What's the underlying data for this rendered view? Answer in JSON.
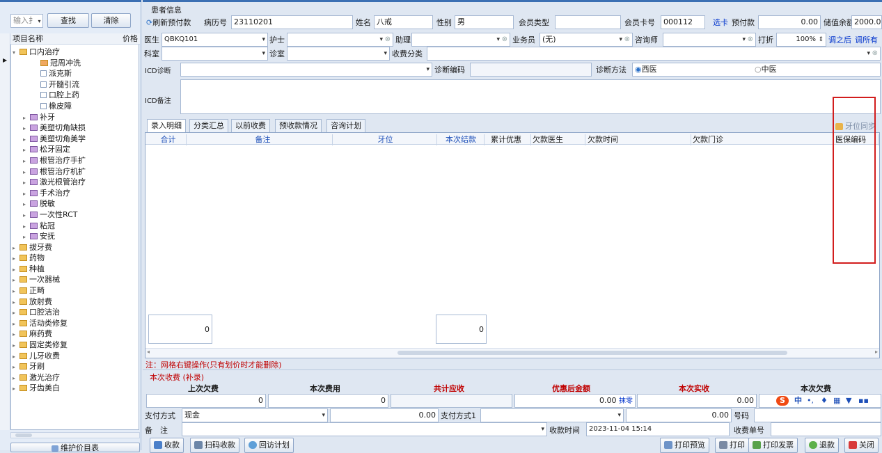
{
  "left": {
    "search_placeholder": "输入扌",
    "find_label": "查找",
    "clear_label": "清除",
    "col_name": "项目名称",
    "col_price": "价格",
    "maintain_label": "维护价目表",
    "tree": [
      {
        "label": "口内治疗",
        "indent": 0,
        "icon": "folder-open",
        "exp": "▾"
      },
      {
        "label": "冠周冲洗",
        "indent": 2,
        "icon": "pen",
        "exp": ""
      },
      {
        "label": "派克斯",
        "indent": 2,
        "icon": "check",
        "exp": ""
      },
      {
        "label": "开髓引流",
        "indent": 2,
        "icon": "check",
        "exp": ""
      },
      {
        "label": "口腔上药",
        "indent": 2,
        "icon": "check",
        "exp": ""
      },
      {
        "label": "橡皮障",
        "indent": 2,
        "icon": "check",
        "exp": ""
      },
      {
        "label": "补牙",
        "indent": 1,
        "icon": "pile",
        "exp": "▸"
      },
      {
        "label": "美塑切角缺损",
        "indent": 1,
        "icon": "pile",
        "exp": "▸"
      },
      {
        "label": "美塑切角美学",
        "indent": 1,
        "icon": "pile",
        "exp": "▸"
      },
      {
        "label": "松牙固定",
        "indent": 1,
        "icon": "pile",
        "exp": "▸"
      },
      {
        "label": "根管治疗手扩",
        "indent": 1,
        "icon": "pile",
        "exp": "▸"
      },
      {
        "label": "根管治疗机扩",
        "indent": 1,
        "icon": "pile",
        "exp": "▸"
      },
      {
        "label": "激光根管治疗",
        "indent": 1,
        "icon": "pile",
        "exp": "▸"
      },
      {
        "label": "手术治疗",
        "indent": 1,
        "icon": "pile",
        "exp": "▸"
      },
      {
        "label": "脱敏",
        "indent": 1,
        "icon": "pile",
        "exp": "▸"
      },
      {
        "label": "一次性RCT",
        "indent": 1,
        "icon": "pile",
        "exp": "▸"
      },
      {
        "label": "粘冠",
        "indent": 1,
        "icon": "pile",
        "exp": "▸"
      },
      {
        "label": "安抚",
        "indent": 1,
        "icon": "pile",
        "exp": "▸"
      },
      {
        "label": "拔牙费",
        "indent": 0,
        "icon": "folder",
        "exp": "▸"
      },
      {
        "label": "药物",
        "indent": 0,
        "icon": "folder",
        "exp": "▸"
      },
      {
        "label": "种植",
        "indent": 0,
        "icon": "folder",
        "exp": "▸"
      },
      {
        "label": "一次器械",
        "indent": 0,
        "icon": "folder",
        "exp": "▸"
      },
      {
        "label": "正畸",
        "indent": 0,
        "icon": "folder",
        "exp": "▸"
      },
      {
        "label": "放射费",
        "indent": 0,
        "icon": "folder",
        "exp": "▸"
      },
      {
        "label": "口腔洁治",
        "indent": 0,
        "icon": "folder",
        "exp": "▸"
      },
      {
        "label": "活动类修复",
        "indent": 0,
        "icon": "folder",
        "exp": "▸"
      },
      {
        "label": "麻药费",
        "indent": 0,
        "icon": "folder",
        "exp": "▸"
      },
      {
        "label": "固定类修复",
        "indent": 0,
        "icon": "folder",
        "exp": "▸"
      },
      {
        "label": "儿牙收费",
        "indent": 0,
        "icon": "folder",
        "exp": "▸"
      },
      {
        "label": "牙刷",
        "indent": 0,
        "icon": "folder",
        "exp": "▸"
      },
      {
        "label": "激光治疗",
        "indent": 0,
        "icon": "folder",
        "exp": "▸"
      },
      {
        "label": "牙齿美白",
        "indent": 0,
        "icon": "folder",
        "exp": "▸"
      }
    ]
  },
  "patient": {
    "title": "患者信息",
    "refresh": "刷新预付款",
    "record_label": "病历号",
    "record_no": "23110201",
    "name_label": "姓名",
    "name": "八戒",
    "gender_label": "性别",
    "gender": "男",
    "member_type_label": "会员类型",
    "member_type": "",
    "card_label": "会员卡号",
    "card_no": "000112",
    "select_card": "选卡",
    "prepay_label": "预付款",
    "prepay": "0.00",
    "balance_label": "储值余额",
    "balance": "2000.0"
  },
  "staff": {
    "doctor_label": "医生",
    "doctor": "QBKQ101",
    "nurse_label": "护士",
    "nurse": "",
    "assistant_label": "助理",
    "assistant": "",
    "sales_label": "业务员",
    "sales": "(无)",
    "consultant_label": "咨询师",
    "consultant": "",
    "discount_label": "打折",
    "discount": "100%",
    "adjust_after": "调之后",
    "adjust_all": "调所有"
  },
  "dept": {
    "dept_label": "科室",
    "dept": "",
    "room_label": "诊室",
    "room": "",
    "category_label": "收费分类",
    "category": ""
  },
  "icd": {
    "label": "ICD诊断",
    "code_label": "诊断编码",
    "method_label": "诊断方法",
    "western": "西医",
    "chinese": "中医",
    "note_label": "ICD备注"
  },
  "tabs": [
    "录入明细",
    "分类汇总",
    "以前收费",
    "预收款情况",
    "咨询计划"
  ],
  "sync_label": "牙位同步",
  "columns": [
    "合计",
    "备注",
    "牙位",
    "本次结款",
    "累计优惠",
    "欠款医生",
    "欠款时间",
    "欠款门诊",
    "医保编码"
  ],
  "totals": {
    "sum": "0",
    "settle": "0"
  },
  "note": "注：网格右键操作(只有划价时才能删除)",
  "billing": {
    "title": "本次收费",
    "subtitle": "(补录)",
    "prev_debt": "上次欠费",
    "this_fee": "本次费用",
    "total_due": "共计应收",
    "after_discount": "优惠后金额",
    "actual": "本次实收",
    "this_debt": "本次欠费",
    "v_prev_debt": "0",
    "v_this_fee": "0",
    "v_after_discount": "0.00",
    "wipe": "抹零",
    "v_actual": "0.00",
    "pay_label": "支付方式",
    "pay_method": "现金",
    "pay_amount": "0.00",
    "pay1_label": "支付方式1",
    "pay1_amount": "0.00",
    "number_label": "号码",
    "remark_label": "备　注",
    "time_label": "收款时间",
    "time": "2023-11-04 15:14",
    "receipt_label": "收费单号"
  },
  "ime": {
    "lang": "中"
  },
  "footer": {
    "collect": "收款",
    "scan": "扫码收款",
    "visit": "回访计划",
    "print_preview": "打印预览",
    "print": "打印",
    "print_invoice": "打印发票",
    "refund": "退款",
    "close": "关闭"
  },
  "colors": {
    "red": "#c00000",
    "blue": "#0033cc",
    "highlight": "#d21d1d"
  }
}
